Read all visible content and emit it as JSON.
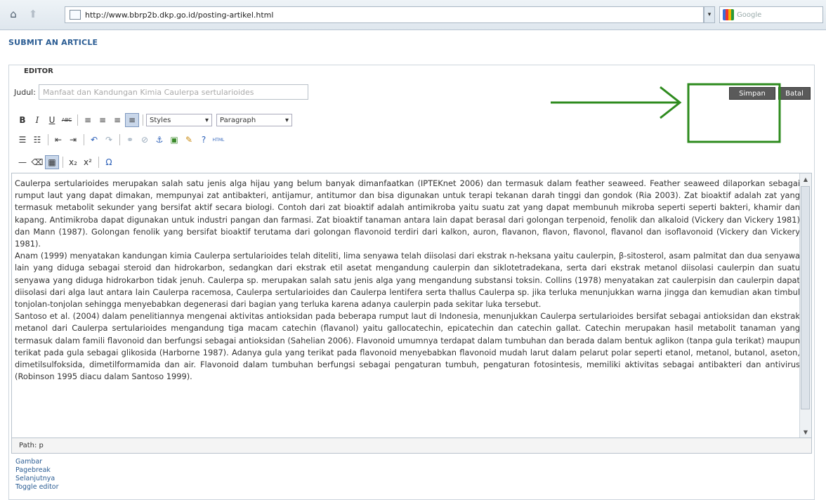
{
  "browser": {
    "url": "http://www.bbrp2b.dkp.go.id/posting-artikel.html",
    "search_placeholder": "Google",
    "home_icon": "home-icon",
    "back_icon": "back-icon"
  },
  "page": {
    "heading": "SUBMIT AN ARTICLE"
  },
  "editor": {
    "legend": "EDITOR",
    "title_label": "Judul:",
    "title_value": "Manfaat dan Kandungan Kimia Caulerpa sertularioides",
    "save_label": "Simpan",
    "cancel_label": "Batal",
    "toolbar": {
      "row1": {
        "buttons": [
          "B",
          "I",
          "U",
          "ABC"
        ],
        "align_icons": [
          "align-left-icon",
          "align-center-icon",
          "align-right-icon",
          "align-justify-icon"
        ],
        "styles_value": "Styles",
        "format_value": "Paragraph"
      },
      "row2": {
        "icons": [
          "bullet-list-icon",
          "numbered-list-icon",
          "outdent-icon",
          "indent-icon",
          "undo-icon",
          "redo-icon",
          "link-icon",
          "unlink-icon",
          "anchor-icon",
          "image-icon",
          "cleanup-icon",
          "help-icon"
        ],
        "html_label": "HTML"
      },
      "row3": {
        "icons": [
          "horizontal-rule-icon",
          "remove-format-icon",
          "visual-aid-icon"
        ],
        "subscript": "x₂",
        "superscript": "x²",
        "special_char": "Ω"
      }
    },
    "paragraphs": [
      "Caulerpa sertularioides merupakan salah satu jenis alga hijau yang belum banyak dimanfaatkan (IPTEKnet 2006) dan termasuk dalam feather seaweed. Feather seaweed dilaporkan sebagai rumput laut yang dapat dimakan, mempunyai zat antibakteri, antijamur, antitumor dan bisa digunakan untuk terapi tekanan darah tinggi dan gondok (Ria 2003). Zat bioaktif adalah zat yang termasuk metabolit sekunder yang bersifat aktif secara biologi. Contoh dari zat bioaktif adalah antimikroba yaitu suatu zat yang dapat membunuh mikroba seperti seperti bakteri, khamir dan kapang. Antimikroba dapat digunakan untuk industri pangan dan farmasi. Zat bioaktif tanaman antara lain dapat berasal dari golongan terpenoid, fenolik dan alkaloid (Vickery dan Vickery 1981) dan Mann (1987). Golongan fenolik yang bersifat bioaktif terutama dari golongan flavonoid terdiri dari kalkon, auron, flavanon, flavon, flavonol, flavanol dan isoflavonoid (Vickery dan Vickery 1981).",
      "Anam (1999) menyatakan kandungan kimia Caulerpa sertularioides telah diteliti, lima senyawa telah diisolasi dari ekstrak n-heksana yaitu caulerpin, β-sitosterol, asam palmitat dan dua senyawa lain yang diduga sebagai steroid dan hidrokarbon, sedangkan dari ekstrak etil asetat mengandung caulerpin dan siklotetradekana, serta dari ekstrak metanol diisolasi caulerpin dan suatu senyawa yang diduga hidrokarbon tidak jenuh. Caulerpa sp. merupakan salah satu jenis alga yang mengandung substansi toksin. Collins (1978) menyatakan zat caulerpisin dan caulerpin dapat diisolasi dari alga laut antara lain Caulerpa racemosa, Caulerpa sertularioides dan Caulerpa lentifera serta thallus Caulerpa sp. jika terluka menunjukkan warna jingga dan kemudian akan timbul tonjolan-tonjolan sehingga menyebabkan degenerasi dari bagian yang terluka karena adanya caulerpin pada sekitar luka tersebut.",
      "Santoso et al. (2004) dalam penelitiannya mengenai aktivitas antioksidan pada beberapa rumput laut di Indonesia, menunjukkan Caulerpa sertularioides bersifat sebagai antioksidan dan ekstrak metanol dari Caulerpa sertularioides mengandung tiga macam catechin (flavanol) yaitu gallocatechin, epicatechin dan catechin gallat. Catechin merupakan hasil metabolit tanaman yang termasuk dalam famili flavonoid dan berfungsi sebagai antioksidan (Sahelian 2006). Flavonoid umumnya terdapat dalam tumbuhan dan berada dalam bentuk aglikon (tanpa gula terikat) maupun terikat pada gula sebagai glikosida (Harborne 1987). Adanya gula yang terikat pada flavonoid menyebabkan flavonoid mudah larut dalam pelarut polar seperti etanol, metanol, butanol, aseton, dimetilsulfoksida, dimetilformamida dan air. Flavonoid dalam tumbuhan berfungsi sebagai pengaturan tumbuh, pengaturan fotosintesis, memiliki aktivitas sebagai antibakteri dan antivirus (Robinson 1995 diacu dalam Santoso 1999)."
    ],
    "path_text": "Path: p",
    "links": [
      "Gambar",
      "Pagebreak",
      "Selanjutnya",
      "Toggle editor"
    ]
  },
  "annotation": {
    "color": "#2e8b1e",
    "icon": "arrow-annotation-icon"
  }
}
